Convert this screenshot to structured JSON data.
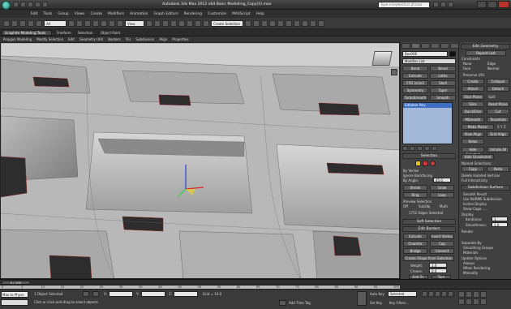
{
  "window": {
    "title": "Autodesk 3ds Max  2012 x64     Basic Modelling_Copy(4).max",
    "search_placeholder": "Type a keyword or phrase"
  },
  "menu": [
    "Edit",
    "Tools",
    "Group",
    "Views",
    "Create",
    "Modifiers",
    "Animation",
    "Graph Editors",
    "Rendering",
    "Customize",
    "MAXScript",
    "Help"
  ],
  "toolbar": {
    "selection_filter": "All",
    "view_dropdown": "View",
    "named_selection": "Create Selection Se"
  },
  "ribbon": {
    "tabs": [
      "Graphite Modeling Tools",
      "Freeform",
      "Selection",
      "Object Paint"
    ],
    "subtabs": [
      "Polygon Modeling",
      "Modify Selection",
      "Edit",
      "Geometry (All)",
      "Borders",
      "Tris",
      "Subdivision",
      "Align",
      "Properties"
    ]
  },
  "viewport": {
    "label": "",
    "colors": {
      "bg": "#8e8e8e",
      "mesh": "#c8c8c8",
      "hole": "#2d2d2d"
    }
  },
  "command_panel": {
    "object_name": "Box006",
    "modifier_list": "Modifier List",
    "mod_buttons": [
      [
        "Bend",
        "Bevel"
      ],
      [
        "Extrude",
        "Lathe"
      ],
      [
        "FFD 3x3x3",
        "Shell"
      ],
      [
        "Symmetry",
        "Taper"
      ],
      [
        "TurboSmooth",
        "Smooth"
      ]
    ],
    "stack_item": "Editable Poly",
    "selection": {
      "title": "Selection",
      "by_vertex": "By Vertex",
      "ignore_backfacing": "Ignore Backfacing",
      "by_angle": "By Angle:",
      "by_angle_value": "45.0",
      "shrink": "Shrink",
      "grow": "Grow",
      "ring": "Ring",
      "loop": "Loop",
      "preview_label": "Preview Selection",
      "preview_off": "Off",
      "preview_subobj": "SubObj",
      "preview_multi": "Multi",
      "status": "1752 Edges Selected"
    },
    "soft_selection": "Soft Selection",
    "edit_borders": {
      "title": "Edit Borders",
      "extrude": "Extrude",
      "insert_vertex": "Insert Vertex",
      "chamfer": "Chamfer",
      "cap": "Cap",
      "bridge": "Bridge",
      "connect": "Connect",
      "create_shape": "Create Shape From Selection",
      "weight_label": "Weight:",
      "weight_value": "1.0",
      "crease_label": "Crease:",
      "crease_value": "0.0",
      "edit_tri": "Edit Tri.",
      "turn": "Turn"
    }
  },
  "right_panel": {
    "edit_geometry": "Edit Geometry",
    "repeat_last": "Repeat Last",
    "constraints": "Constraints",
    "none": "None",
    "edge": "Edge",
    "face": "Face",
    "normal": "Normal",
    "preserve_uvs": "Preserve UVs",
    "create": "Create",
    "collapse": "Collapse",
    "attach": "Attach",
    "detach": "Detach",
    "slice_plane": "Slice Plane",
    "split": "Split",
    "slice": "Slice",
    "reset_plane": "Reset Plane",
    "quickslice": "QuickSlice",
    "cut": "Cut",
    "msmooth": "MSmooth",
    "tessellate": "Tessellate",
    "make_planar": "Make Planar",
    "view_align": "View Align",
    "grid_align": "Grid Align",
    "relax": "Relax",
    "hide_selected": "Hide Selected",
    "unhide_all": "Unhide All",
    "hide_unselected": "Hide Unselected",
    "named_selections": "Named Selections:",
    "copy": "Copy",
    "paste": "Paste",
    "delete_isolated": "Delete Isolated Vertices",
    "full_interactivity": "Full Interactivity",
    "subdivision_surface": "Subdivision Surface",
    "smooth_result": "Smooth Result",
    "use_nurms": "Use NURMS Subdivision",
    "isoline_display": "Isoline Display",
    "show_cage": "Show Cage......",
    "display": "Display",
    "iterations_label": "Iterations:",
    "iterations_value": "1",
    "smoothness_label": "Smoothness:",
    "smoothness_value": "1.0",
    "render": "Render",
    "separate_by": "Separate By",
    "smoothing_groups": "Smoothing Groups",
    "materials": "Materials",
    "update_options": "Update Options",
    "always": "Always",
    "when_rendering": "When Rendering",
    "manually": "Manually"
  },
  "timeline": {
    "frame": "0 / 100",
    "ticks": [
      "0",
      "5",
      "10",
      "15",
      "20",
      "25",
      "30",
      "35",
      "40",
      "45",
      "50",
      "55",
      "60",
      "65",
      "70",
      "75",
      "80",
      "85",
      "90",
      "95",
      "100"
    ]
  },
  "status": {
    "max_to_physx": "Max to Physx",
    "objects_selected": "1 Object Selected",
    "hint": "Click or click-and-drag to select objects",
    "x_label": "X:",
    "y_label": "Y:",
    "z_label": "Z:",
    "grid": "Grid = 10.0",
    "auto_key": "Auto Key",
    "selected": "Selected",
    "set_key": "Set Key",
    "key_filters": "Key Filters...",
    "add_time_tag": "Add Time Tag"
  }
}
